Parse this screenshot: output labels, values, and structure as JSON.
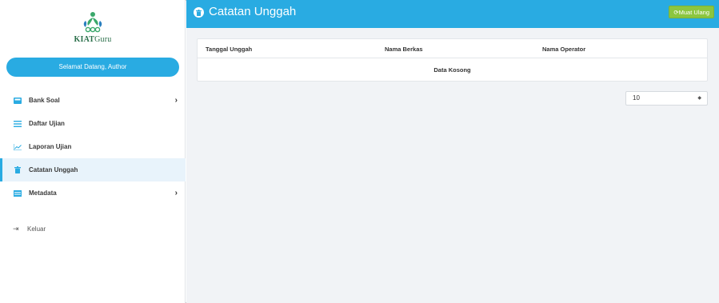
{
  "brand": {
    "name_bold": "KIAT",
    "name_regular": "Guru",
    "accent_color": "#29abe2",
    "logo_color": "#3aa86b"
  },
  "sidebar": {
    "welcome": "Selamat Datang, Author",
    "items": [
      {
        "label": "Bank Soal",
        "icon": "inbox-tray-icon",
        "has_submenu": true,
        "active": false
      },
      {
        "label": "Daftar Ujian",
        "icon": "list-icon",
        "has_submenu": false,
        "active": false
      },
      {
        "label": "Laporan Ujian",
        "icon": "line-chart-icon",
        "has_submenu": false,
        "active": false
      },
      {
        "label": "Catatan Unggah",
        "icon": "trash-icon",
        "has_submenu": false,
        "active": true
      },
      {
        "label": "Metadata",
        "icon": "table-icon",
        "has_submenu": true,
        "active": false
      }
    ],
    "logout": "Keluar"
  },
  "header": {
    "title": "Catatan Unggah",
    "reload_label": "Muat Ulang",
    "reload_color": "#8cc63f"
  },
  "table": {
    "columns": [
      "Tanggal Unggah",
      "Nama Berkas",
      "Nama Operator"
    ],
    "empty_text": "Data Kosong"
  },
  "pagination": {
    "page_size": "10"
  }
}
